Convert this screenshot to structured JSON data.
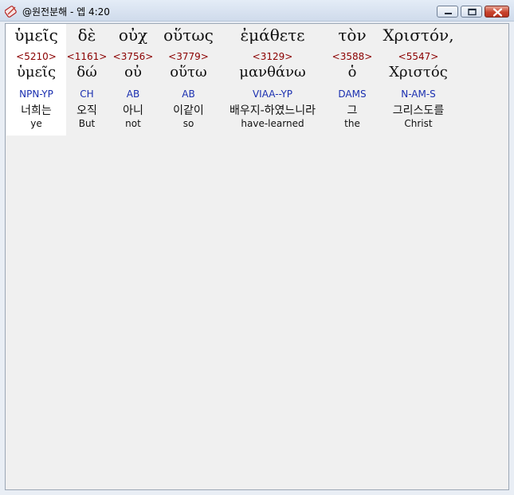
{
  "window": {
    "title": "@원전분해 - 엡 4:20",
    "buttons": {
      "minimize": "minimize-icon",
      "maximize": "maximize-icon",
      "close": "close-icon"
    }
  },
  "words": [
    {
      "greek": "ὑμεῖς",
      "strong": "<5210>",
      "lemma": "ὑμεῖς",
      "parse": "NPN-YP",
      "korean": "너희는",
      "english": "ye"
    },
    {
      "greek": "δὲ",
      "strong": "<1161>",
      "lemma": "δώ",
      "parse": "CH",
      "korean": "오직",
      "english": "But"
    },
    {
      "greek": "οὐχ",
      "strong": "<3756>",
      "lemma": "οὐ",
      "parse": "AB",
      "korean": "아니",
      "english": "not"
    },
    {
      "greek": "οὕτως",
      "strong": "<3779>",
      "lemma": "οὕτω",
      "parse": "AB",
      "korean": "이같이",
      "english": "so"
    },
    {
      "greek": "ἐμάθετε",
      "strong": "<3129>",
      "lemma": "μανθάνω",
      "parse": "VIAA--YP",
      "korean": "배우지-하였느니라",
      "english": "have-learned"
    },
    {
      "greek": "τὸν",
      "strong": "<3588>",
      "lemma": "ὁ",
      "parse": "DAMS",
      "korean": "그",
      "english": "the"
    },
    {
      "greek": "Χριστόν,",
      "strong": "<5547>",
      "lemma": "Χριστός",
      "parse": "N-AM-S",
      "korean": "그리스도를",
      "english": "Christ"
    }
  ],
  "colors": {
    "strong": "#8b0000",
    "parse": "#1a2fb0",
    "selected_background": "#ffffff",
    "client_background": "#f0f0f0"
  }
}
